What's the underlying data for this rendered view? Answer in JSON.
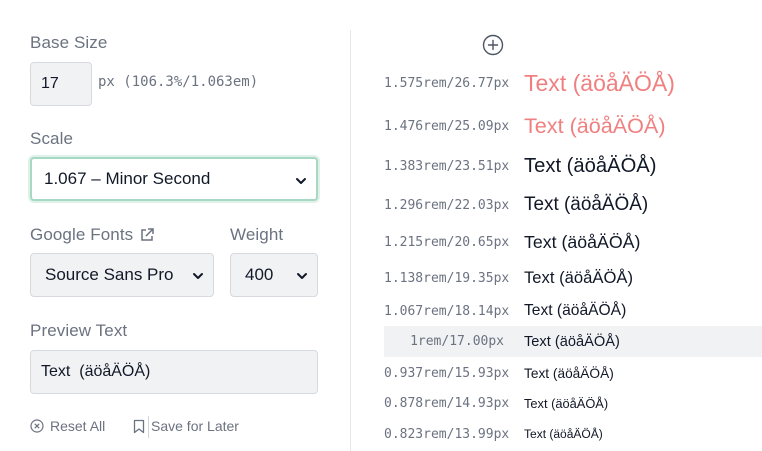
{
  "base_size": {
    "label": "Base Size",
    "value": "17",
    "note": "px (106.3%/1.063em)"
  },
  "scale": {
    "label": "Scale",
    "selected": "1.067 – Minor Second"
  },
  "google_fonts": {
    "label": "Google Fonts",
    "selected": "Source Sans Pro"
  },
  "weight": {
    "label": "Weight",
    "selected": "400"
  },
  "preview_text": {
    "label": "Preview Text",
    "value": "Text  (äöåÄÖÅ)"
  },
  "actions": {
    "reset": "Reset All",
    "save": "Save for Later"
  },
  "accent_color": "#f08080",
  "scale_rows": [
    {
      "size": "1.575rem/26.77px",
      "text": "Text (äöåÄÖÅ)",
      "accent": true
    },
    {
      "size": "1.476rem/25.09px",
      "text": "Text (äöåÄÖÅ)",
      "accent": true
    },
    {
      "size": "1.383rem/23.51px",
      "text": "Text (äöåÄÖÅ)",
      "accent": false
    },
    {
      "size": "1.296rem/22.03px",
      "text": "Text (äöåÄÖÅ)",
      "accent": false
    },
    {
      "size": "1.215rem/20.65px",
      "text": "Text (äöåÄÖÅ)",
      "accent": false
    },
    {
      "size": "1.138rem/19.35px",
      "text": "Text (äöåÄÖÅ)",
      "accent": false
    },
    {
      "size": "1.067rem/18.14px",
      "text": "Text (äöåÄÖÅ)",
      "accent": false
    },
    {
      "size": "1rem/17.00px",
      "text": "Text (äöåÄÖÅ)",
      "accent": false,
      "highlighted": true
    },
    {
      "size": "0.937rem/15.93px",
      "text": "Text (äöåÄÖÅ)",
      "accent": false
    },
    {
      "size": "0.878rem/14.93px",
      "text": "Text (äöåÄÖÅ)",
      "accent": false
    },
    {
      "size": "0.823rem/13.99px",
      "text": "Text (äöåÄÖÅ)",
      "accent": false
    }
  ]
}
